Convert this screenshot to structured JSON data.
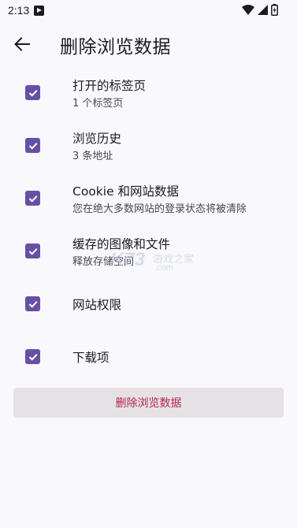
{
  "status_bar": {
    "time": "2:13",
    "icons": [
      "app-notification-icon",
      "wifi-icon",
      "signal-icon",
      "battery-charging-icon"
    ]
  },
  "header": {
    "back_icon": "arrow-left-icon",
    "title": "删除浏览数据"
  },
  "options": [
    {
      "title": "打开的标签页",
      "subtitle": "1 个标签页",
      "checked": true
    },
    {
      "title": "浏览历史",
      "subtitle": "3 条地址",
      "checked": true
    },
    {
      "title": "Cookie 和网站数据",
      "subtitle": "您在绝大多数网站的登录状态将被清除",
      "checked": true
    },
    {
      "title": "缓存的图像和文件",
      "subtitle": "释放存储空间",
      "checked": true
    },
    {
      "title": "网站权限",
      "checked": true
    },
    {
      "title": "下载项",
      "checked": true
    }
  ],
  "delete_button": {
    "label": "删除浏览数据"
  },
  "watermark": {
    "brand": "K73",
    "text": "游戏之家",
    "domain": ".com"
  },
  "colors": {
    "accent": "#6750a4",
    "danger": "#b3264f",
    "background": "#f9f8fc",
    "button_bg": "#e6e1e5"
  }
}
